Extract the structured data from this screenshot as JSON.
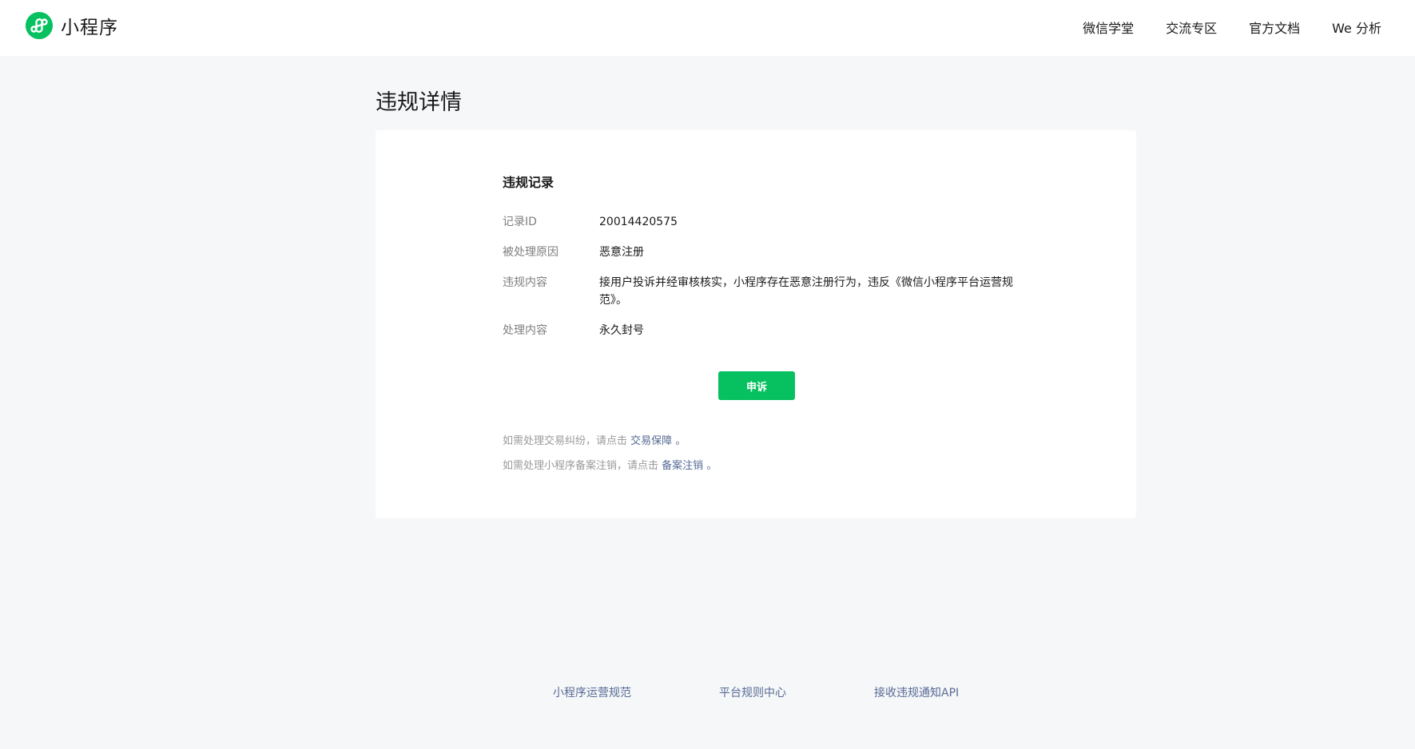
{
  "header": {
    "logo_text": "小程序",
    "logo_icon": "miniprogram-logo-icon",
    "nav": [
      "微信学堂",
      "交流专区",
      "官方文档",
      "We 分析"
    ]
  },
  "page": {
    "title": "违规详情"
  },
  "card": {
    "section_title": "违规记录",
    "rows": [
      {
        "label": "记录ID",
        "value": "20014420575"
      },
      {
        "label": "被处理原因",
        "value": "恶意注册"
      },
      {
        "label": "违规内容",
        "value": "接用户投诉并经审核核实，小程序存在恶意注册行为，违反《微信小程序平台运营规范》。"
      },
      {
        "label": "处理内容",
        "value": "永久封号"
      }
    ],
    "appeal_button": "申诉",
    "hints": [
      {
        "text": "如需处理交易纠纷，请点击",
        "link": "交易保障",
        "suffix": "。"
      },
      {
        "text": "如需处理小程序备案注销，请点击",
        "link": "备案注销",
        "suffix": "。"
      }
    ]
  },
  "footer": {
    "links": [
      "小程序运营规范",
      "平台规则中心",
      "接收违规通知API"
    ]
  },
  "colors": {
    "brand_green": "#07c160",
    "link_blue": "#576b95",
    "background": "#f6f7f9"
  }
}
